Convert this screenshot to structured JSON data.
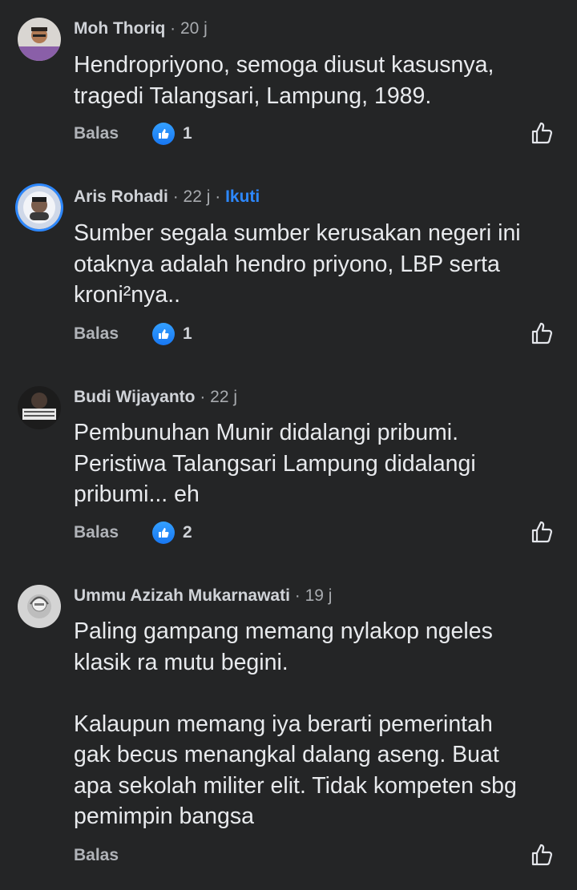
{
  "comments": [
    {
      "author": "Moh Thoriq",
      "time": "· 20 j",
      "follow": "",
      "body": "Hendropriyono, semoga diusut kasusnya,\ntragedi Talangsari, Lampung, 1989.",
      "reply": "Balas",
      "likes": "1"
    },
    {
      "author": "Aris Rohadi",
      "time": "· 22 j ·",
      "follow": "Ikuti",
      "body": "Sumber segala sumber kerusakan negeri ini\notaknya adalah hendro priyono, LBP serta\nkroni²nya..",
      "reply": "Balas",
      "likes": "1"
    },
    {
      "author": "Budi Wijayanto",
      "time": "· 22 j",
      "follow": "",
      "body": "Pembunuhan Munir didalangi pribumi.\nPeristiwa Talangsari Lampung didalangi\npribumi... eh",
      "reply": "Balas",
      "likes": "2"
    },
    {
      "author": "Ummu Azizah Mukarnawati",
      "time": "· 19 j",
      "follow": "",
      "body": "Paling gampang memang nylakop ngeles\nklasik ra mutu begini.\n\nKalaupun memang iya berarti pemerintah\ngak becus menangkal dalang aseng. Buat\napa sekolah militer elit. Tidak kompeten sbg\npemimpin bangsa",
      "reply": "Balas",
      "likes": ""
    }
  ],
  "colors": {
    "background": "#242526",
    "follow": "#2d88ff",
    "like_badge": "#1877f2"
  },
  "icons": {
    "reaction": "thumbs-up-badge-icon",
    "like": "thumbs-up-outline-icon"
  }
}
